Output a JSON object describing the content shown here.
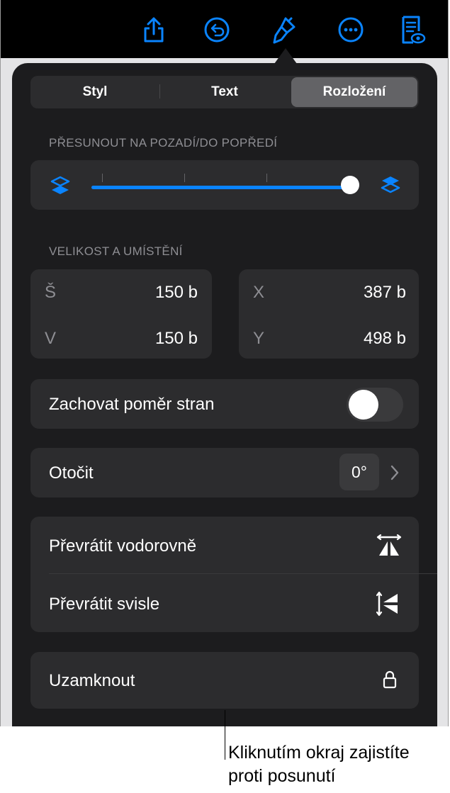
{
  "toolbar": {
    "icons": [
      "share-icon",
      "undo-icon",
      "format-brush-icon",
      "more-icon",
      "reading-view-icon"
    ]
  },
  "tabs": [
    {
      "label": "Styl",
      "active": false
    },
    {
      "label": "Text",
      "active": false
    },
    {
      "label": "Rozložení",
      "active": true
    }
  ],
  "arrange": {
    "title": "PŘESUNOUT NA POZADÍ/DO POPŘEDÍ",
    "slider_value": 1.0
  },
  "size_position": {
    "title": "VELIKOST A UMÍSTĚNÍ",
    "width_label": "Š",
    "width_value": "150 b",
    "height_label": "V",
    "height_value": "150 b",
    "x_label": "X",
    "x_value": "387 b",
    "y_label": "Y",
    "y_value": "498 b"
  },
  "constrain": {
    "label": "Zachovat poměr stran",
    "on": false
  },
  "rotate": {
    "label": "Otočit",
    "value": "0°"
  },
  "flip": {
    "horizontal_label": "Převrátit vodorovně",
    "vertical_label": "Převrátit svisle"
  },
  "lock": {
    "label": "Uzamknout"
  },
  "callout": {
    "line1": "Kliknutím okraj zajistíte",
    "line2": "proti posunutí"
  },
  "colors": {
    "accent": "#0a84ff",
    "panel": "#1c1c1e",
    "card": "#2c2c2e"
  }
}
